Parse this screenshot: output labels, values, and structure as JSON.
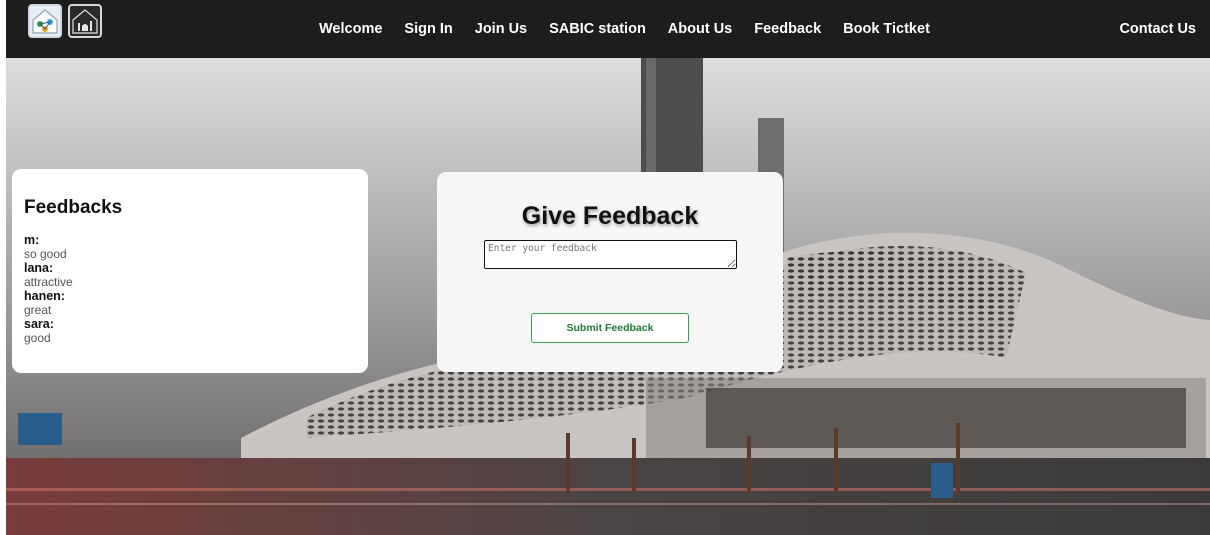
{
  "nav": {
    "items": [
      {
        "label": "Welcome"
      },
      {
        "label": "Sign In"
      },
      {
        "label": "Join Us"
      },
      {
        "label": "SABIC station"
      },
      {
        "label": "About Us"
      },
      {
        "label": "Feedback"
      },
      {
        "label": "Book Tictket"
      }
    ],
    "contact": "Contact Us"
  },
  "feedbacks": {
    "title": "Feedbacks",
    "entries": [
      {
        "name": "m:",
        "text": "so good"
      },
      {
        "name": "lana:",
        "text": "attractive"
      },
      {
        "name": "hanen:",
        "text": "great"
      },
      {
        "name": "sara:",
        "text": "good"
      }
    ]
  },
  "form": {
    "title": "Give Feedback",
    "placeholder": "Enter your feedback",
    "submit_label": "Submit Feedback"
  },
  "icons": {
    "logo_left": "network-house-logo-icon",
    "logo_right": "mosque-logo-icon"
  },
  "colors": {
    "navbar": "#1d1d1d",
    "submit_border": "#3ba153",
    "submit_text": "#1f7b36"
  }
}
